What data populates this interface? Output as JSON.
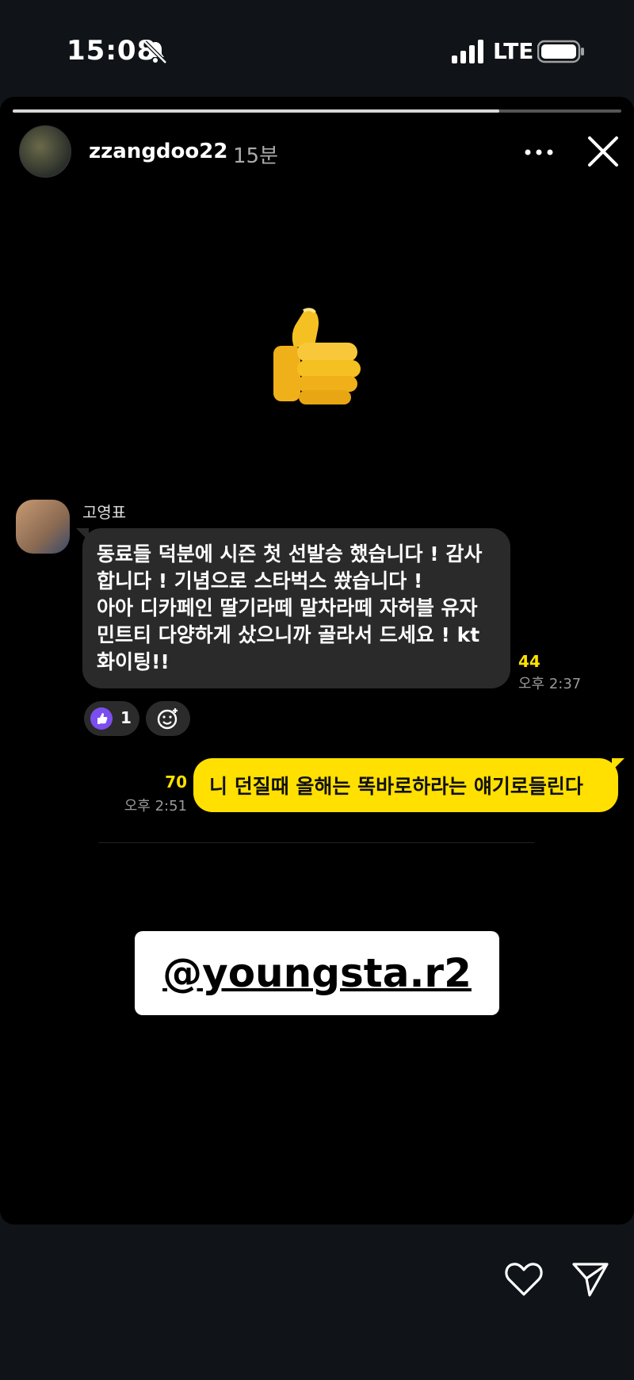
{
  "status_bar": {
    "time": "15:08",
    "network": "LTE",
    "icons": [
      "bell-slash-icon",
      "signal-icon",
      "battery-icon"
    ]
  },
  "story": {
    "username": "zzangdoo22",
    "time_ago": "15분",
    "progress": 0.8,
    "sticker": "👍",
    "mention": "@youngsta.r2"
  },
  "chat": {
    "incoming": {
      "sender": "고영표",
      "text": "동료들 덕분에 시즌 첫 선발승 했습니다 ! 감사\n합니다 ! 기념으로 스타벅스 쐈습니다 !\n아아 디카페인 딸기라떼 말차라떼 자허블 유자\n민트티 다양하게 샀으니까 골라서 드세요 ! kt\n화이팅!!",
      "unread": "44",
      "time": "오후 2:37",
      "reaction_count": "1"
    },
    "outgoing": {
      "text": "니 던질때 올해는 똑바로하라는 얘기로들린다",
      "unread": "70",
      "time": "오후 2:51"
    }
  },
  "colors": {
    "kakao_yellow": "#ffe000",
    "incoming_bubble": "#2a2a2a",
    "like_purple": "#7b4ef0"
  }
}
